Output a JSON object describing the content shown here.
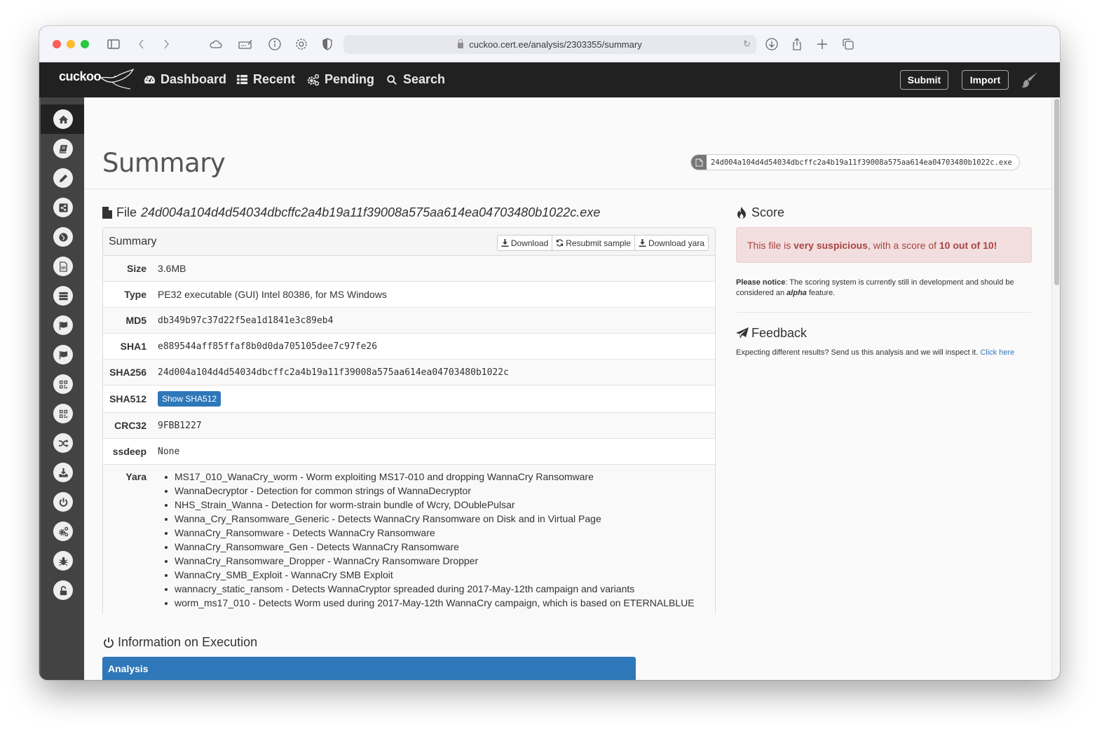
{
  "browser": {
    "url": "cuckoo.cert.ee/analysis/2303355/summary",
    "toolbar_icons": [
      "sidebar-toggle-icon",
      "back-icon",
      "forward-icon",
      "cloud-icon",
      "keyboard-sign-icon",
      "info-icon",
      "gear-icon",
      "shield-icon"
    ],
    "right_icons": [
      "download-icon",
      "share-icon",
      "new-tab-icon",
      "tabs-overview-icon"
    ]
  },
  "navbar": {
    "logo": "cuckoo",
    "items": [
      {
        "label": "Dashboard",
        "icon": "dashboard-icon"
      },
      {
        "label": "Recent",
        "icon": "list-icon"
      },
      {
        "label": "Pending",
        "icon": "cogs-icon"
      },
      {
        "label": "Search",
        "icon": "search-icon"
      }
    ],
    "submit_label": "Submit",
    "import_label": "Import",
    "theme_icon": "paintbrush-icon"
  },
  "sidebar": {
    "items": [
      {
        "icon": "home-icon",
        "active": true
      },
      {
        "icon": "book-icon"
      },
      {
        "icon": "pencil-icon"
      },
      {
        "icon": "share-icon"
      },
      {
        "icon": "globe-icon"
      },
      {
        "icon": "file-code-icon"
      },
      {
        "icon": "server-icon"
      },
      {
        "icon": "flag-icon"
      },
      {
        "icon": "flag-icon"
      },
      {
        "icon": "qrcode-icon"
      },
      {
        "icon": "qrcode-icon"
      },
      {
        "icon": "random-icon"
      },
      {
        "icon": "download-icon"
      },
      {
        "icon": "power-icon"
      },
      {
        "icon": "cogs-icon"
      },
      {
        "icon": "bug-icon"
      },
      {
        "icon": "unlock-icon"
      }
    ]
  },
  "page": {
    "title": "Summary",
    "file_badge": "24d004a104d4d54034dbcffc2a4b19a11f39008a575aa614ea04703480b1022c.exe"
  },
  "file": {
    "heading_prefix": "File",
    "filename": "24d004a104d4d54034dbcffc2a4b19a11f39008a575aa614ea04703480b1022c.exe",
    "panel_title": "Summary",
    "buttons": {
      "download": "Download",
      "resubmit": "Resubmit sample",
      "download_yara": "Download yara"
    },
    "rows": [
      {
        "key": "Size",
        "value": "3.6MB",
        "mono": false
      },
      {
        "key": "Type",
        "value": "PE32 executable (GUI) Intel 80386, for MS Windows",
        "mono": false
      },
      {
        "key": "MD5",
        "value": "db349b97c37d22f5ea1d1841e3c89eb4",
        "mono": true
      },
      {
        "key": "SHA1",
        "value": "e889544aff85ffaf8b0d0da705105dee7c97fe26",
        "mono": true
      },
      {
        "key": "SHA256",
        "value": "24d004a104d4d54034dbcffc2a4b19a11f39008a575aa614ea04703480b1022c",
        "mono": true
      },
      {
        "key": "SHA512",
        "button": "Show SHA512"
      },
      {
        "key": "CRC32",
        "value": "9FBB1227",
        "mono": true
      },
      {
        "key": "ssdeep",
        "value": "None",
        "mono": true
      }
    ],
    "yara_label": "Yara",
    "yara": [
      "MS17_010_WanaCry_worm - Worm exploiting MS17-010 and dropping WannaCry Ransomware",
      "WannaDecryptor - Detection for common strings of WannaDecryptor",
      "NHS_Strain_Wanna - Detection for worm-strain bundle of Wcry, DOublePulsar",
      "Wanna_Cry_Ransomware_Generic - Detects WannaCry Ransomware on Disk and in Virtual Page",
      "WannaCry_Ransomware - Detects WannaCry Ransomware",
      "WannaCry_Ransomware_Gen - Detects WannaCry Ransomware",
      "WannaCry_Ransomware_Dropper - WannaCry Ransomware Dropper",
      "WannaCry_SMB_Exploit - WannaCry SMB Exploit",
      "wannacry_static_ransom - Detects WannaCryptor spreaded during 2017-May-12th campaign and variants",
      "worm_ms17_010 - Detects Worm used during 2017-May-12th WannaCry campaign, which is based on ETERNALBLUE"
    ]
  },
  "execution": {
    "heading": "Information on Execution",
    "panel_title": "Analysis"
  },
  "score": {
    "heading": "Score",
    "text_prefix": "This file is ",
    "verdict": "very suspicious",
    "text_mid": ", with a score of ",
    "score_text": "10 out of 10!",
    "score_value": 10,
    "score_max": 10,
    "notice_bold": "Please notice",
    "notice_text": ": The scoring system is currently still in development and should be considered an ",
    "notice_em": "alpha",
    "notice_end": " feature.",
    "alert_bg": "#f2dede",
    "alert_color": "#a94442"
  },
  "feedback": {
    "heading": "Feedback",
    "text": "Expecting different results? Send us this analysis and we will inspect it. ",
    "link": "Click here"
  },
  "colors": {
    "navbar": "#212121",
    "sidebar": "#434343",
    "primary": "#2e77b8",
    "link": "#337ab7"
  }
}
